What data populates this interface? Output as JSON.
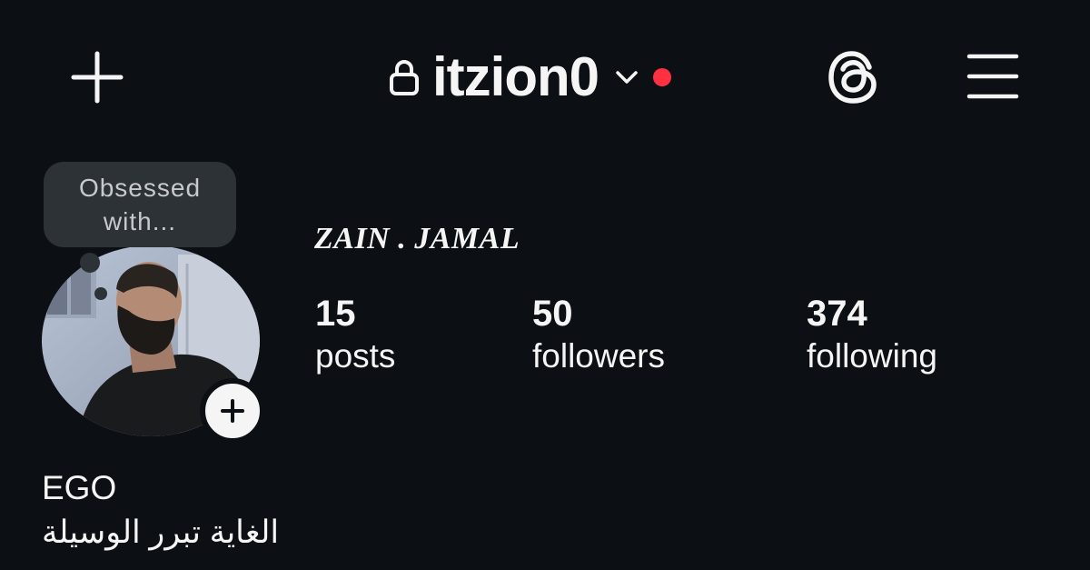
{
  "header": {
    "username": "itzion0",
    "icons": {
      "create": "plus-icon",
      "lock": "lock-icon",
      "switch_account": "chevron-down-icon",
      "threads": "threads-icon",
      "menu": "hamburger-menu-icon"
    },
    "notification_dot_color": "#ff3040"
  },
  "profile": {
    "note": {
      "line1": "Obsessed",
      "line2": "with..."
    },
    "full_name": "ZAIN . JAMAL",
    "stats": {
      "posts": {
        "count": "15",
        "label": "posts"
      },
      "followers": {
        "count": "50",
        "label": "followers"
      },
      "following": {
        "count": "374",
        "label": "following"
      }
    },
    "bio": {
      "line1": "EGO",
      "line2": "الغاية تبرر الوسيلة"
    }
  },
  "colors": {
    "background": "#0c1014",
    "text": "#f5f5f5",
    "note_bubble": "#2d3237"
  }
}
